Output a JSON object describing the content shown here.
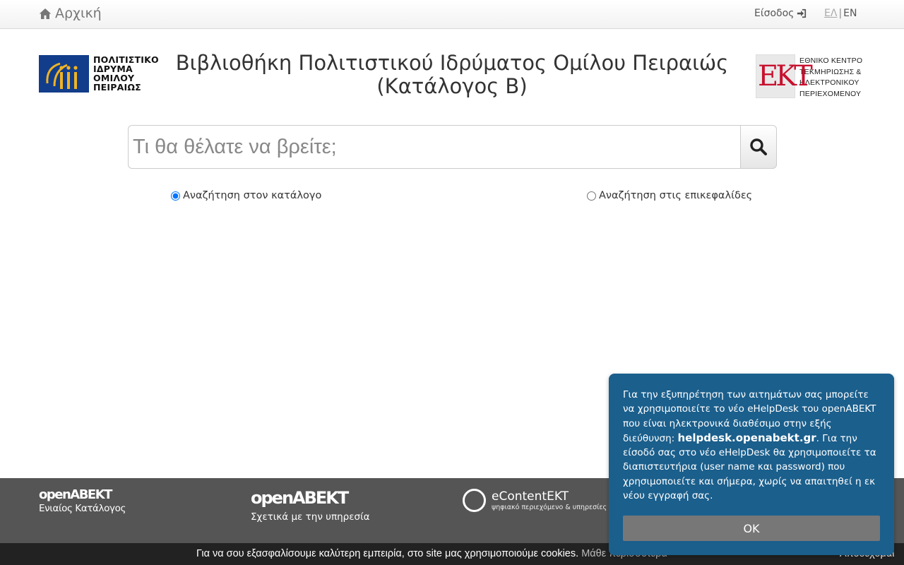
{
  "nav": {
    "home_label": "Αρχική",
    "login_label": "Είσοδος",
    "lang_el": "ΕΛ",
    "lang_sep": "|",
    "lang_en": "EN"
  },
  "header": {
    "logo_left_lines": [
      "ΠΟΛΙΤΙΣΤΙΚΟ",
      "ΙΔΡΥΜΑ",
      "ΟΜΙΛΟΥ",
      "ΠΕΙΡΑΙΩΣ"
    ],
    "title_line1": "Βιβλιοθήκη Πολιτιστικού Ιδρύματος Ομίλου Πειραιώς",
    "title_line2": "(Κατάλογος Β)",
    "logo_right_mark": "EKT",
    "logo_right_lines": [
      "ΕΘΝΙΚΟ ΚΕΝΤΡΟ",
      "ΤΕΚΜΗΡΙΩΣΗΣ &",
      "ΗΛΕΚΤΡΟΝΙΚΟΥ",
      "ΠΕΡΙΕΧΟΜΕΝΟΥ"
    ]
  },
  "search": {
    "placeholder": "Τι θα θέλατε να βρείτε;",
    "value": "",
    "option_catalog": "Αναζήτηση στον κατάλογο",
    "option_headings": "Αναζήτηση στις επικεφαλίδες",
    "selected": "catalog"
  },
  "footer": {
    "col1_brand": "openABEKT",
    "col1_sub": "Ενιαίος Κατάλογος",
    "col2_brand": "openABEKT",
    "col2_sub": "Σχετικά με την υπηρεσία",
    "col3_brand_a": "eContent",
    "col3_brand_b": "EKT",
    "col3_tag": "ψηφιακό περιεχόμενο & υπηρεσίες"
  },
  "cookie": {
    "text": "Για να σου εξασφαλίσουμε καλύτερη εμπειρία, στο site μας χρησιμοποιούμε cookies.",
    "more": "Μάθε περισσότερα",
    "accept": "Αποδέχομαι"
  },
  "popup": {
    "text_before": "Για την εξυπηρέτηση των αιτημάτων σας μπορείτε να χρησιμοποιείτε το νέο eHelpDesk του openABEKT που είναι ηλεκτρονικά διαθέσιμο στην εξής διεύθυνση: ",
    "text_bold": "helpdesk.openabekt.gr",
    "text_after": ". Για την είσοδό σας στο νέο eHelpDesk θα χρησιμοποιείτε τα διαπιστευτήρια (user name και password) που χρησιμοποιείτε και σήμερα, χωρίς να απαιτηθεί η εκ νέου εγγραφή σας.",
    "ok_label": "OK"
  },
  "colors": {
    "popup_bg": "#1b5f8c",
    "footer_bg": "#555555",
    "cookie_bg": "#222222",
    "logo_blue": "#123d8a",
    "logo_gold": "#f0b323",
    "ekt_red": "#c8102e"
  }
}
